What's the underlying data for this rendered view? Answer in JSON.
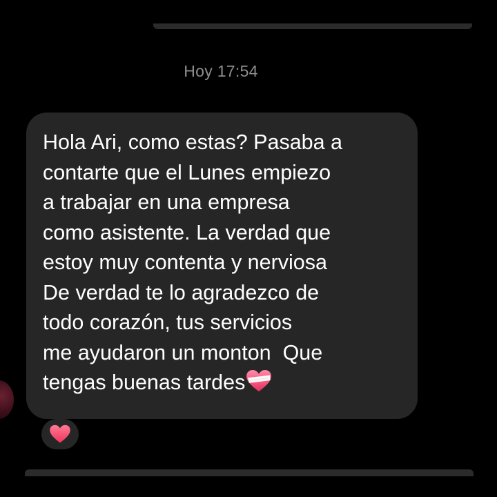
{
  "timestamp": "Hoy 17:54",
  "message": {
    "lines": [
      "Hola Ari, como estas? Pasaba a",
      "contarte que el Lunes empiezo",
      "a trabajar en una empresa",
      "como asistente. La verdad que",
      "estoy muy contenta y nerviosa",
      "De verdad te lo agradezco de",
      "todo corazón, tus servicios",
      "me ayudaron un monton  Que",
      "tengas buenas tardes"
    ],
    "trailing_emoji": "heart-with-bandage-icon"
  },
  "reaction": {
    "emoji": "red-heart-icon"
  },
  "colors": {
    "background": "#000000",
    "bubble": "#262626",
    "text": "#ffffff",
    "timestamp": "#8e8e8e",
    "heart": "#ff4d6d"
  }
}
